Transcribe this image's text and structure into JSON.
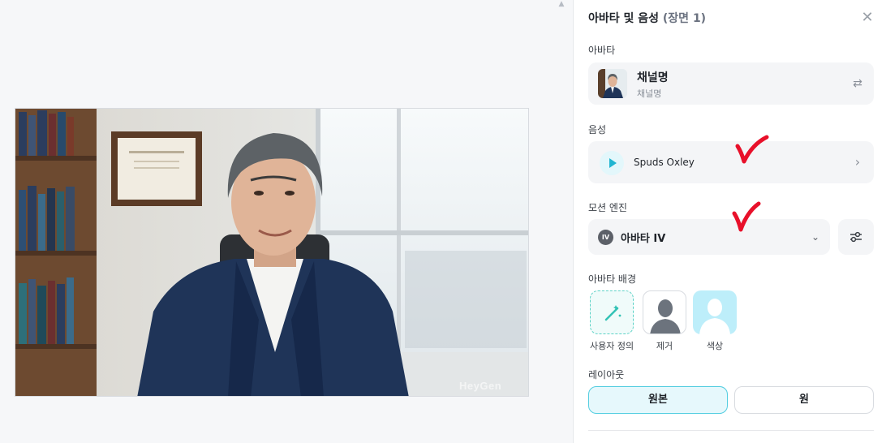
{
  "panel": {
    "title": "아바타 및 음성",
    "scene": "(장면 1)",
    "close_icon": "close-icon"
  },
  "avatar": {
    "section_label": "아바타",
    "name": "채널명",
    "subtitle": "채널명",
    "swap_icon": "swap-icon"
  },
  "voice": {
    "section_label": "음성",
    "name": "Spuds Oxley"
  },
  "motion_engine": {
    "section_label": "모션 엔진",
    "badge": "IV",
    "selected": "아바타 IV"
  },
  "background": {
    "section_label": "아바타 배경",
    "options": [
      {
        "label": "사용자 정의",
        "icon": "magic-wand-icon"
      },
      {
        "label": "제거",
        "icon": "person-silhouette-icon"
      },
      {
        "label": "색상",
        "icon": "person-silhouette-icon",
        "color": "#bdeefa"
      }
    ]
  },
  "layout": {
    "section_label": "레이아웃",
    "options": [
      "원본",
      "원"
    ],
    "selected": "원본"
  },
  "preview": {
    "watermark": "HeyGen"
  },
  "colors": {
    "accent": "#52cde0",
    "annotation_red": "#e8102a"
  }
}
